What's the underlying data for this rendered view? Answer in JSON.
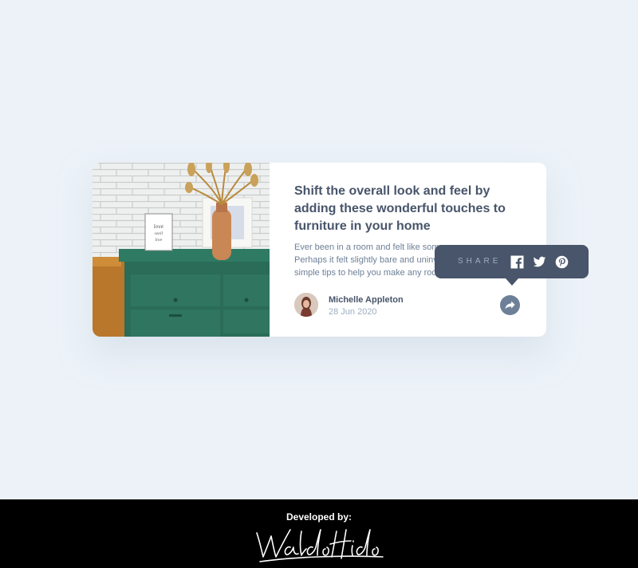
{
  "article": {
    "title": "Shift the overall look and feel by adding these wonderful touches to furniture in your home",
    "excerpt_lines": [
      "Ever been in a room and felt like som",
      "Perhaps it felt slightly bare and uninv",
      "simple tips to help you make any roo"
    ],
    "image_alt": "green drawers with a dried plant vase and framed print against a white brick wall",
    "frame_text": "love well live wonderfully"
  },
  "author": {
    "name": "Michelle Appleton",
    "date": "28 Jun 2020"
  },
  "share": {
    "label": "SHARE",
    "icons": [
      "facebook-icon",
      "twitter-icon",
      "pinterest-icon"
    ],
    "button_icon": "share-arrow-icon"
  },
  "footer": {
    "developed_label": "Developed by:",
    "signature_text": "Waldo Hidalgo"
  },
  "colors": {
    "background": "#ecf2f8",
    "card": "#ffffff",
    "title": "#48556a",
    "text": "#6e8098",
    "muted": "#9daec2",
    "popup": "#48556a",
    "footer": "#000000"
  }
}
